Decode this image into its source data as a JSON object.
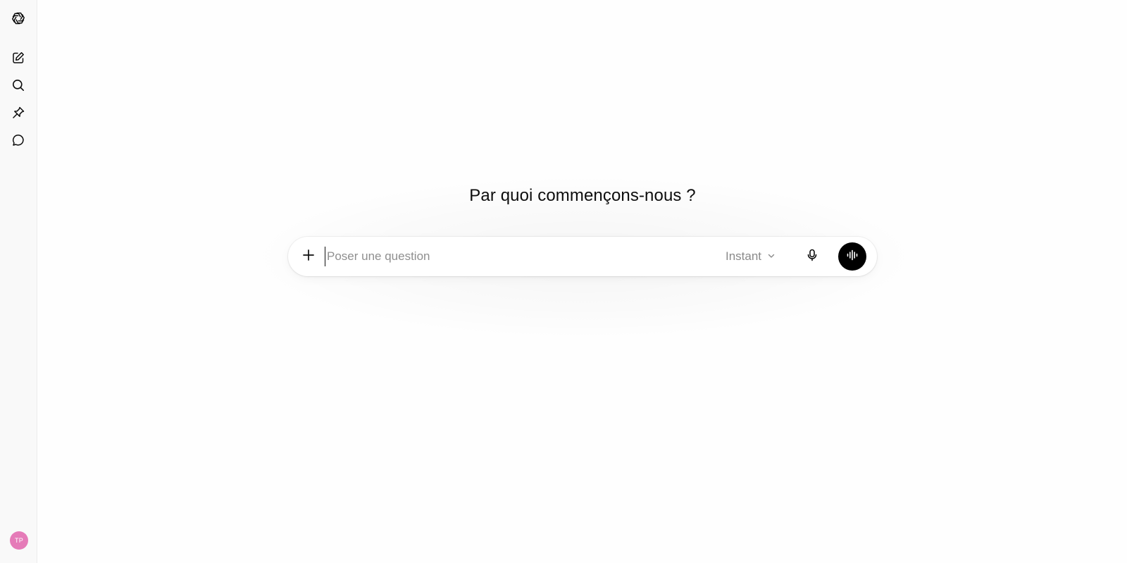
{
  "sidebar": {
    "logo_icon": "openai-logo-icon",
    "items": [
      {
        "icon": "new-chat-icon"
      },
      {
        "icon": "search-icon"
      },
      {
        "icon": "pin-icon"
      },
      {
        "icon": "chat-bubble-icon"
      }
    ],
    "avatar_initials": "TP",
    "avatar_color": "#e57bb8"
  },
  "header": {
    "corner_icon": "temporary-chat-icon"
  },
  "main": {
    "heading": "Par quoi commençons-nous ?",
    "composer": {
      "placeholder": "Poser une question",
      "value": "",
      "model_label": "Instant",
      "voice_button_color": "#000000"
    }
  }
}
